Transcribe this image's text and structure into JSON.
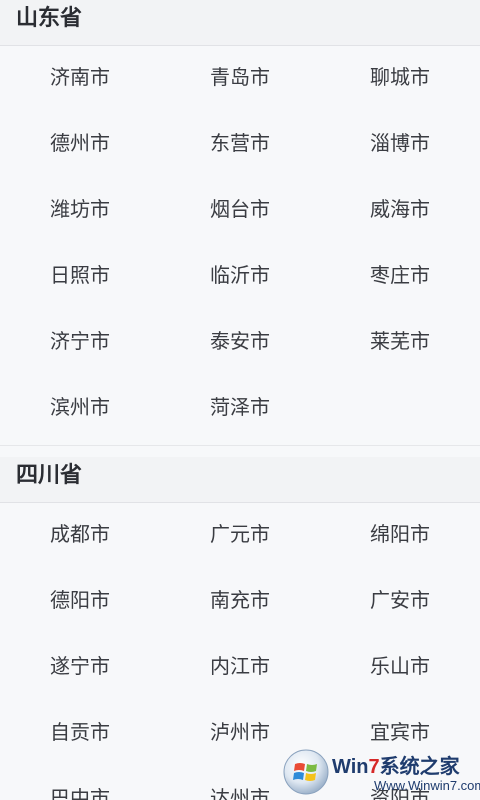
{
  "provinces": [
    {
      "name": "山东省",
      "cities": [
        "济南市",
        "青岛市",
        "聊城市",
        "德州市",
        "东营市",
        "淄博市",
        "潍坊市",
        "烟台市",
        "威海市",
        "日照市",
        "临沂市",
        "枣庄市",
        "济宁市",
        "泰安市",
        "莱芜市",
        "滨州市",
        "菏泽市"
      ]
    },
    {
      "name": "四川省",
      "cities": [
        "成都市",
        "广元市",
        "绵阳市",
        "德阳市",
        "南充市",
        "广安市",
        "遂宁市",
        "内江市",
        "乐山市",
        "自贡市",
        "泸州市",
        "宜宾市",
        "巴中市",
        "达州市",
        "资阳市"
      ]
    }
  ],
  "watermark": {
    "logo_prefix": "Win",
    "logo_seven": "7",
    "logo_suffix": "系统之家",
    "url": "Www.Winwin7.com"
  }
}
